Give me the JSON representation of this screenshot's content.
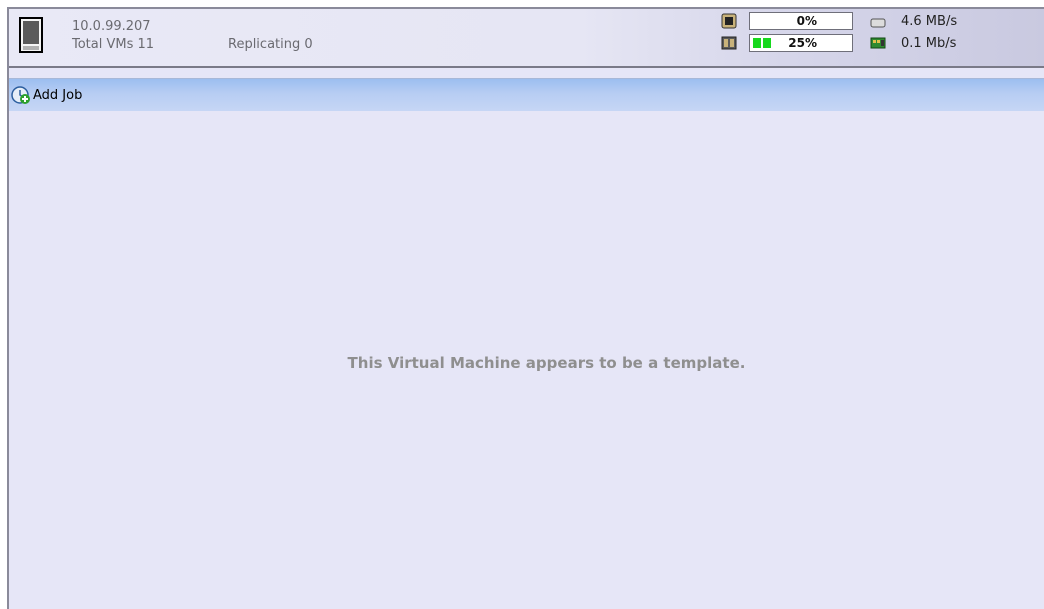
{
  "header": {
    "host_ip": "10.0.99.207",
    "total_vms_label": "Total VMs 11",
    "replicating_label": "Replicating 0",
    "server_icon": "server-icon",
    "cpu": {
      "icon": "cpu-chip-icon",
      "percent_label": "0%",
      "value": 0
    },
    "memory": {
      "icon": "memory-icon",
      "percent_label": "25%",
      "value": 25
    },
    "disk": {
      "icon": "disk-icon",
      "rate": "4.6 MB/s"
    },
    "network": {
      "icon": "network-card-icon",
      "rate": "0.1 Mb/s"
    }
  },
  "toolbar": {
    "add_job_label": "Add Job",
    "add_job_icon": "add-job-icon"
  },
  "content": {
    "message": "This Virtual Machine appears to be a template."
  },
  "colors": {
    "background": "#e6e6f7",
    "toolbar": "#b7cdf3",
    "meter_fill": "#16d81d",
    "message_text": "#8f8f8f"
  }
}
